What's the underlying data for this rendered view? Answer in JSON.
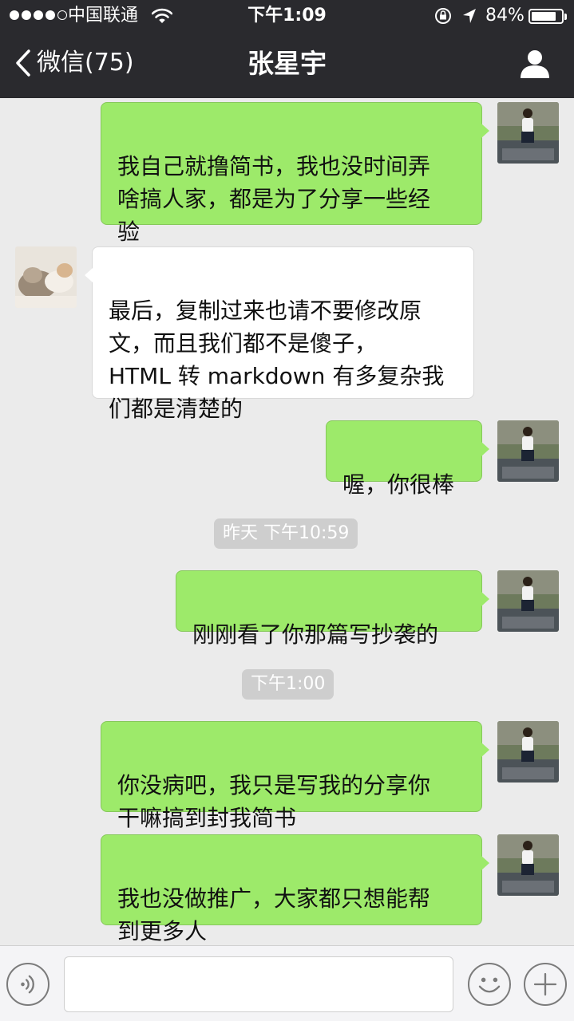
{
  "status_bar": {
    "carrier": "中国联通",
    "time": "下午1:09",
    "battery_percent_label": "84%",
    "battery_level": 0.84,
    "signal_bars": 4,
    "signal_max": 5
  },
  "nav": {
    "back_label": "微信(75)",
    "title": "张星宇",
    "back_icon": "chevron-left-icon",
    "profile_icon": "person-icon"
  },
  "chat": {
    "messages": [
      {
        "sender": "me",
        "text": "我自己就撸简书，我也没时间弄\n啥搞人家，都是为了分享一些经\n验"
      },
      {
        "sender": "them",
        "text": "最后，复制过来也请不要修改原\n文，而且我们都不是傻子，\nHTML 转 markdown 有多复杂我\n们都是清楚的"
      },
      {
        "sender": "me",
        "text": "喔，你很棒"
      },
      {
        "type": "timestamp",
        "text": "昨天 下午10:59"
      },
      {
        "sender": "me",
        "text": "刚刚看了你那篇写抄袭的"
      },
      {
        "type": "timestamp",
        "text": "下午1:00"
      },
      {
        "sender": "me",
        "text": "你没病吧，我只是写我的分享你\n干嘛搞到封我简书"
      },
      {
        "sender": "me",
        "text": "我也没做推广，大家都只想能帮\n到更多人"
      }
    ]
  },
  "input_bar": {
    "voice_icon": "voice-icon",
    "emoji_icon": "emoji-icon",
    "plus_icon": "plus-icon",
    "text_value": ""
  },
  "colors": {
    "bar_bg": "#2a2a2e",
    "chat_bg": "#ebebeb",
    "my_bubble": "#9dea6a",
    "their_bubble": "#ffffff",
    "timestamp_bg": "#cecece"
  }
}
